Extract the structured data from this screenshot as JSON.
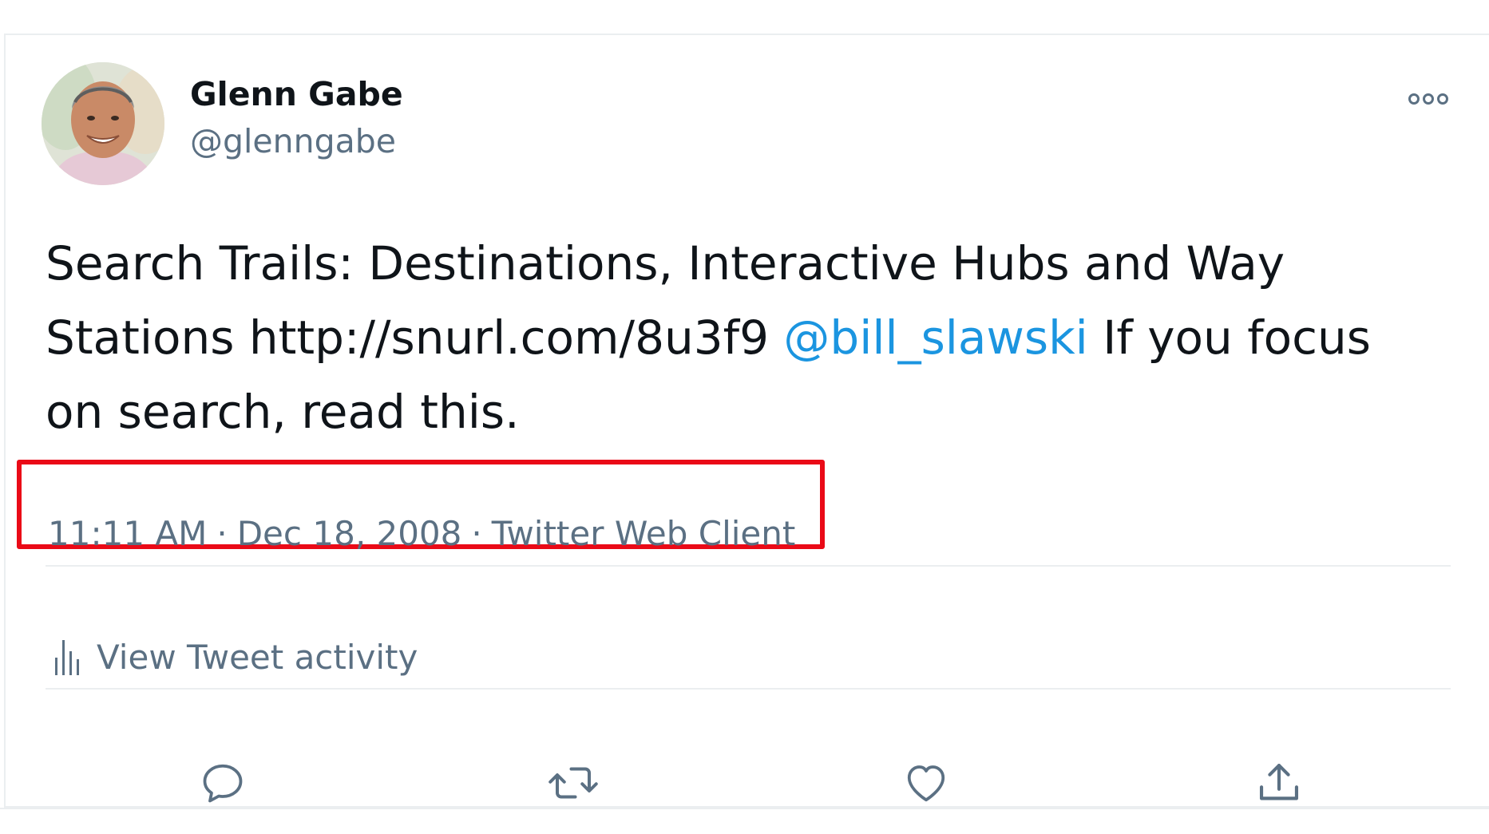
{
  "tweet": {
    "author": {
      "display_name": "Glenn Gabe",
      "handle": "@glenngabe"
    },
    "text": {
      "before_mention": "Search Trails: Destinations, Interactive Hubs and Way Stations http://snurl.com/8u3f9 ",
      "mention": "@bill_slawski",
      "after_mention": " If you focus on search, read this."
    },
    "meta": {
      "time": "11:11 AM",
      "separator": "·",
      "date": "Dec 18, 2008",
      "client": "Twitter Web Client"
    },
    "activity_label": "View Tweet activity"
  },
  "icons": {
    "more": "more-icon",
    "activity": "bar-chart-icon",
    "reply": "reply-icon",
    "retweet": "retweet-icon",
    "like": "heart-icon",
    "share": "share-icon"
  },
  "colors": {
    "text_primary": "#0f1419",
    "text_secondary": "#5b7083",
    "link": "#1b95e0",
    "highlight_border": "#ea0a17",
    "divider": "#ebeef0"
  }
}
